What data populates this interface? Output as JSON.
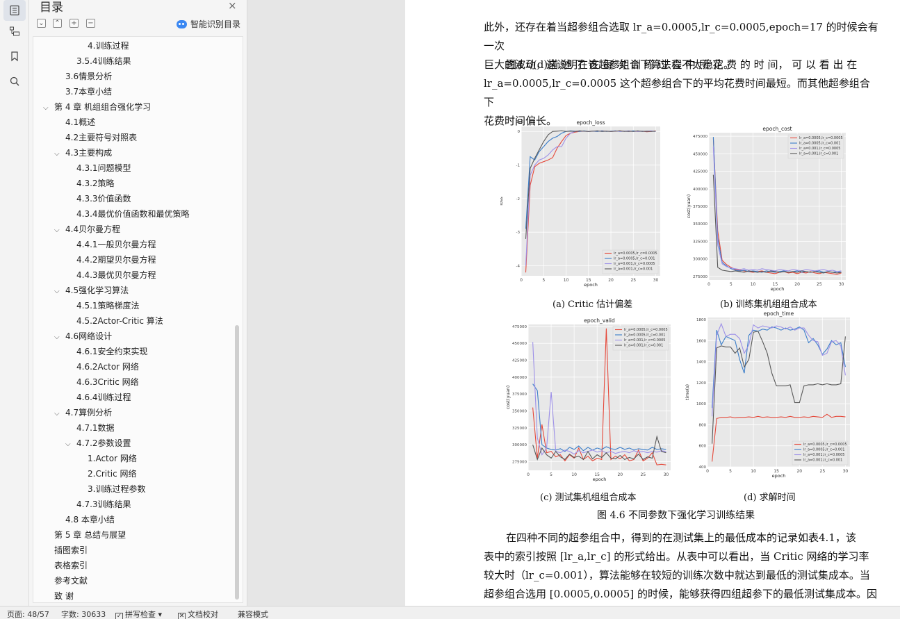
{
  "sidebar": {
    "icons": [
      "toc-icon",
      "navigation-tree-icon",
      "bookmark-icon",
      "search-icon"
    ]
  },
  "nav": {
    "title": "目录",
    "close": "×",
    "buttons": [
      "⌄",
      "⌃",
      "+",
      "−"
    ],
    "ai_toc_label": "智能识别目录",
    "items": [
      {
        "text": "4.训练过程",
        "level": 4,
        "chevron": ""
      },
      {
        "text": "3.5.4训练结果",
        "level": 3,
        "chevron": ""
      },
      {
        "text": "3.6情景分析",
        "level": 2,
        "chevron": ""
      },
      {
        "text": "3.7本章小结",
        "level": 2,
        "chevron": ""
      },
      {
        "text": "第 4 章  机组组合强化学习",
        "level": 1,
        "chevron": "⌵"
      },
      {
        "text": "4.1概述",
        "level": 2,
        "chevron": ""
      },
      {
        "text": "4.2主要符号对照表",
        "level": 2,
        "chevron": ""
      },
      {
        "text": "4.3主要构成",
        "level": 2,
        "chevron": "⌵"
      },
      {
        "text": "4.3.1问题模型",
        "level": 3,
        "chevron": ""
      },
      {
        "text": "4.3.2策略",
        "level": 3,
        "chevron": ""
      },
      {
        "text": "4.3.3价值函数",
        "level": 3,
        "chevron": ""
      },
      {
        "text": "4.3.4最优价值函数和最优策略",
        "level": 3,
        "chevron": ""
      },
      {
        "text": "4.4贝尔曼方程",
        "level": 2,
        "chevron": "⌵"
      },
      {
        "text": "4.4.1一般贝尔曼方程",
        "level": 3,
        "chevron": ""
      },
      {
        "text": "4.4.2期望贝尔曼方程",
        "level": 3,
        "chevron": ""
      },
      {
        "text": "4.4.3最优贝尔曼方程",
        "level": 3,
        "chevron": ""
      },
      {
        "text": "4.5强化学习算法",
        "level": 2,
        "chevron": "⌵"
      },
      {
        "text": "4.5.1策略梯度法",
        "level": 3,
        "chevron": ""
      },
      {
        "text": "4.5.2Actor-Critic 算法",
        "level": 3,
        "chevron": ""
      },
      {
        "text": "4.6网络设计",
        "level": 2,
        "chevron": "⌵"
      },
      {
        "text": "4.6.1安全约束实现",
        "level": 3,
        "chevron": ""
      },
      {
        "text": "4.6.2Actor 网络",
        "level": 3,
        "chevron": ""
      },
      {
        "text": "4.6.3Critic 网络",
        "level": 3,
        "chevron": ""
      },
      {
        "text": "4.6.4训练过程",
        "level": 3,
        "chevron": ""
      },
      {
        "text": "4.7算例分析",
        "level": 2,
        "chevron": "⌵"
      },
      {
        "text": "4.7.1数据",
        "level": 3,
        "chevron": ""
      },
      {
        "text": "4.7.2参数设置",
        "level": 3,
        "chevron": "⌵"
      },
      {
        "text": "1.Actor 网络",
        "level": 4,
        "chevron": ""
      },
      {
        "text": "2.Critic 网络",
        "level": 4,
        "chevron": ""
      },
      {
        "text": "3.训练过程参数",
        "level": 4,
        "chevron": ""
      },
      {
        "text": "4.7.3训练结果",
        "level": 3,
        "chevron": ""
      },
      {
        "text": "4.8  本章小结",
        "level": 2,
        "chevron": ""
      },
      {
        "text": "第 5 章  总结与展望",
        "level": 1,
        "chevron": ""
      },
      {
        "text": "插图索引",
        "level": 1,
        "chevron": ""
      },
      {
        "text": "表格索引",
        "level": 1,
        "chevron": ""
      },
      {
        "text": "参考文献",
        "level": 1,
        "chevron": ""
      },
      {
        "text": "致  谢",
        "level": 1,
        "chevron": ""
      }
    ]
  },
  "doc": {
    "p1_lines": [
      "此外，还存在着当超参组合选取 lr_a=0.0005,lr_c=0.0005,epoch=17 的时候会有一次",
      "巨大的波动，这说明在该超参组合下算法会不太稳定。"
    ],
    "p2_lines": [
      "图4.6(d)描 述 了 在 每 次 训 练 过 程 中 所 花 费 的 时 间， 可 以 看 出 在",
      "lr_a=0.0005,lr_c=0.0005 这个超参组合下的平均花费时间最短。而其他超参组合下",
      "花费时间偏长。"
    ],
    "captions": {
      "a": "(a) Critic 估计偏差",
      "b": "(b) 训练集机组组合成本",
      "c": "(c) 测试集机组组合成本",
      "d": "(d) 求解时间",
      "figure": "图 4.6    不同参数下强化学习训练结果"
    },
    "p3_lines": [
      "在四种不同的超参组合中，得到的在测试集上的最低成本的记录如表4.1，该",
      "表中的索引按照  [lr_a,lr_c] 的形式给出。从表中可以看出，当  Critic 网络的学习率",
      "较大时（lr_c=0.001），算法能够在较短的训练次数中就达到最低的测试集成本。当",
      "超参组合选用  [0.0005,0.0005] 的时候，能够获得四组超参下的最低测试集成本。因"
    ]
  },
  "status": {
    "page": "页面: 48/57",
    "words": "字数: 30633",
    "spell": "拼写检查",
    "proof": "文档校对",
    "compat": "兼容模式"
  },
  "colors": {
    "red": "#e5483a",
    "blue": "#3a7dc9",
    "violet": "#9d90e8",
    "gray": "#585858",
    "plot_bg": "#e8e8e8"
  },
  "chart_data": [
    {
      "type": "line",
      "title": "epoch_loss",
      "xlabel": "epoch",
      "ylabel": "loss",
      "y_multiplier_label": "1e6",
      "xlim": [
        0,
        31
      ],
      "ylim": [
        -4.3,
        0.15
      ],
      "xticks": [
        0,
        5,
        10,
        15,
        20,
        25,
        30
      ],
      "yticks": [
        0,
        -1,
        -2,
        -3,
        -4
      ],
      "legend_position": "bottom-right",
      "x": [
        1,
        2,
        3,
        4,
        5,
        6,
        7,
        8,
        9,
        10,
        11,
        12,
        13,
        14,
        15,
        16,
        17,
        18,
        19,
        20,
        21,
        22,
        23,
        24,
        25,
        26,
        27,
        28,
        29,
        30
      ],
      "series": [
        {
          "name": "lr_a=0.0005,lr_c=0.0005",
          "values": [
            -4.2,
            -1.6,
            -1.05,
            -0.95,
            -0.9,
            -0.85,
            -0.78,
            -0.5,
            -0.3,
            -0.12,
            -0.05,
            -0.02,
            0,
            0.01,
            0,
            0.01,
            0,
            0.02,
            0.01,
            0,
            0.01,
            0.02,
            0.01,
            0,
            0.01,
            0,
            0.01,
            -0.01,
            0,
            0.02
          ]
        },
        {
          "name": "lr_a=0.0005,lr_c=0.001",
          "values": [
            -2.9,
            -0.75,
            -0.85,
            -0.6,
            -0.45,
            -0.3,
            -0.2,
            -0.15,
            -0.05,
            0,
            0.02,
            0.01,
            0,
            0.02,
            0,
            0.01,
            0,
            0.02,
            0,
            0.01,
            0.02,
            0,
            0.01,
            0,
            0.02,
            0,
            0.01,
            0,
            0.01,
            0
          ]
        },
        {
          "name": "lr_a=0.001,lr_c=0.0005",
          "values": [
            -4.0,
            -1.3,
            -1.0,
            -0.85,
            -0.8,
            -0.7,
            -0.55,
            -0.45,
            -0.45,
            -0.2,
            -0.05,
            0,
            0.02,
            0.01,
            0,
            0.01,
            0.02,
            0,
            0.01,
            0,
            0.02,
            0,
            0.01,
            0.02,
            0,
            0.01,
            0,
            0.01,
            0.02,
            0
          ]
        },
        {
          "name": "lr_a=0.001,lr_c=0.001",
          "values": [
            -3.2,
            -1.1,
            -0.8,
            -0.55,
            -0.3,
            -0.1,
            0,
            0.01,
            0.02,
            0,
            0.01,
            0,
            0.02,
            0.01,
            0,
            0.01,
            0.02,
            0,
            0.01,
            0,
            0.01,
            0.02,
            0,
            0.01,
            0,
            0.02,
            0,
            0.01,
            0,
            0.01
          ]
        }
      ]
    },
    {
      "type": "line",
      "title": "epoch_cost",
      "xlabel": "epoch",
      "ylabel": "cost(yuan)",
      "xlim": [
        0,
        31
      ],
      "ylim": [
        270000,
        480000
      ],
      "xticks": [
        0,
        5,
        10,
        15,
        20,
        25,
        30
      ],
      "yticks": [
        275000,
        300000,
        325000,
        350000,
        375000,
        400000,
        425000,
        450000,
        475000
      ],
      "legend_position": "top-right",
      "x": [
        1,
        2,
        3,
        4,
        5,
        6,
        7,
        8,
        9,
        10,
        11,
        12,
        13,
        14,
        15,
        16,
        17,
        18,
        19,
        20,
        21,
        22,
        23,
        24,
        25,
        26,
        27,
        28,
        29,
        30
      ],
      "series": [
        {
          "name": "lr_a=0.0005,lr_c=0.0005",
          "values": [
            472000,
            340000,
            298000,
            292000,
            288000,
            285000,
            284000,
            283000,
            282000,
            281000,
            282000,
            283000,
            281000,
            280000,
            279000,
            281000,
            282000,
            280000,
            281000,
            279000,
            281000,
            280000,
            282000,
            280000,
            279000,
            281000,
            280000,
            279000,
            278000,
            280000
          ]
        },
        {
          "name": "lr_a=0.0005,lr_c=0.001",
          "values": [
            474000,
            330000,
            295000,
            290000,
            286000,
            284000,
            283000,
            284000,
            282000,
            283000,
            282000,
            281000,
            283000,
            282000,
            281000,
            282000,
            283000,
            281000,
            282000,
            283000,
            281000,
            282000,
            281000,
            282000,
            283000,
            281000,
            282000,
            281000,
            282000,
            281000
          ]
        },
        {
          "name": "lr_a=0.001,lr_c=0.0005",
          "values": [
            460000,
            320000,
            293000,
            289000,
            287000,
            286000,
            285000,
            286000,
            284000,
            285000,
            284000,
            286000,
            285000,
            284000,
            283000,
            285000,
            284000,
            283000,
            285000,
            284000,
            283000,
            285000,
            284000,
            283000,
            284000,
            285000,
            283000,
            284000,
            282000,
            283000
          ]
        },
        {
          "name": "lr_a=0.001,lr_c=0.001",
          "values": [
            420000,
            288000,
            284000,
            283000,
            282000,
            283000,
            282000,
            281000,
            283000,
            282000,
            281000,
            282000,
            281000,
            283000,
            282000,
            281000,
            282000,
            281000,
            282000,
            281000,
            283000,
            282000,
            281000,
            282000,
            281000,
            280000,
            282000,
            281000,
            280000,
            281000
          ]
        }
      ]
    },
    {
      "type": "line",
      "title": "epoch_valid",
      "xlabel": "epoch",
      "ylabel": "cost(yuan)",
      "xlim": [
        0,
        31
      ],
      "ylim": [
        262000,
        478000
      ],
      "xticks": [
        0,
        5,
        10,
        15,
        20,
        25,
        30
      ],
      "yticks": [
        275000,
        300000,
        325000,
        350000,
        375000,
        400000,
        425000,
        450000,
        475000
      ],
      "legend_position": "top-right",
      "x": [
        1,
        2,
        3,
        4,
        5,
        6,
        7,
        8,
        9,
        10,
        11,
        12,
        13,
        14,
        15,
        16,
        17,
        18,
        19,
        20,
        21,
        22,
        23,
        24,
        25,
        26,
        27,
        28,
        29,
        30
      ],
      "series": [
        {
          "name": "lr_a=0.0005,lr_c=0.0005",
          "values": [
            355000,
            280000,
            330000,
            288000,
            290000,
            282000,
            285000,
            276000,
            285000,
            280000,
            295000,
            278000,
            283000,
            276000,
            280000,
            278000,
            472000,
            278000,
            283000,
            279000,
            285000,
            276000,
            278000,
            292000,
            276000,
            280000,
            288000,
            270000,
            271000,
            270000
          ]
        },
        {
          "name": "lr_a=0.0005,lr_c=0.001",
          "values": [
            390000,
            380000,
            300000,
            295000,
            293000,
            292000,
            294000,
            290000,
            296000,
            293000,
            298000,
            291000,
            296000,
            292000,
            295000,
            293000,
            297000,
            294000,
            293000,
            296000,
            293000,
            295000,
            292000,
            294000,
            293000,
            292000,
            296000,
            293000,
            294000,
            293000
          ]
        },
        {
          "name": "lr_a=0.001,lr_c=0.0005",
          "values": [
            452000,
            310000,
            285000,
            295000,
            378000,
            290000,
            288000,
            292000,
            290000,
            286000,
            291000,
            288000,
            290000,
            292000,
            289000,
            291000,
            288000,
            290000,
            287000,
            289000,
            290000,
            288000,
            291000,
            289000,
            290000,
            288000,
            290000,
            289000,
            291000,
            290000
          ]
        },
        {
          "name": "lr_a=0.001,lr_c=0.001",
          "values": [
            300000,
            278000,
            295000,
            285000,
            280000,
            290000,
            282000,
            278000,
            286000,
            281000,
            283000,
            278000,
            290000,
            279000,
            285000,
            281000,
            288000,
            280000,
            279000,
            284000,
            278000,
            281000,
            279000,
            286000,
            278000,
            282000,
            280000,
            312000,
            290000,
            288000
          ]
        }
      ]
    },
    {
      "type": "line",
      "title": "epoch_time",
      "xlabel": "epoch",
      "ylabel": "time(s)",
      "xlim": [
        0,
        31
      ],
      "ylim": [
        400,
        1820
      ],
      "xticks": [
        0,
        5,
        10,
        15,
        20,
        25,
        30
      ],
      "yticks": [
        400,
        600,
        800,
        1000,
        1200,
        1400,
        1600,
        1800
      ],
      "legend_position": "bottom-right",
      "x": [
        1,
        2,
        3,
        4,
        5,
        6,
        7,
        8,
        9,
        10,
        11,
        12,
        13,
        14,
        15,
        16,
        17,
        18,
        19,
        20,
        21,
        22,
        23,
        24,
        25,
        26,
        27,
        28,
        29,
        30
      ],
      "series": [
        {
          "name": "lr_a=0.0005,lr_c=0.0005",
          "values": [
            450,
            860,
            870,
            870,
            875,
            865,
            870,
            870,
            875,
            870,
            880,
            870,
            875,
            870,
            870,
            875,
            870,
            880,
            870,
            870,
            875,
            870,
            880,
            875,
            870,
            900,
            870,
            880,
            880,
            875
          ]
        },
        {
          "name": "lr_a=0.0005,lr_c=0.001",
          "values": [
            960,
            1700,
            1560,
            1640,
            1620,
            1600,
            1420,
            1290,
            1650,
            1700,
            1690,
            1710,
            1700,
            1730,
            1720,
            1700,
            1720,
            1700,
            1710,
            1730,
            1700,
            1580,
            1620,
            1560,
            1470,
            1520,
            1600,
            1560,
            1580,
            1350
          ]
        },
        {
          "name": "lr_a=0.001,lr_c=0.0005",
          "values": [
            880,
            1650,
            1760,
            1640,
            1660,
            1660,
            1620,
            1480,
            1560,
            1750,
            1720,
            1740,
            1730,
            1720,
            1740,
            1730,
            1710,
            1730,
            1700,
            1720,
            1720,
            1650,
            1600,
            1590,
            1460,
            1480,
            1590,
            1600,
            1550,
            1270
          ]
        },
        {
          "name": "lr_a=0.001,lr_c=0.001",
          "values": [
            620,
            1530,
            1550,
            1540,
            1540,
            1480,
            1530,
            1350,
            1420,
            1680,
            1690,
            1590,
            1480,
            1290,
            1170,
            1170,
            1170,
            1180,
            1010,
            1010,
            1170,
            1180,
            1180,
            1190,
            1180,
            1190,
            1180,
            1180,
            1190,
            1640
          ]
        }
      ]
    }
  ]
}
